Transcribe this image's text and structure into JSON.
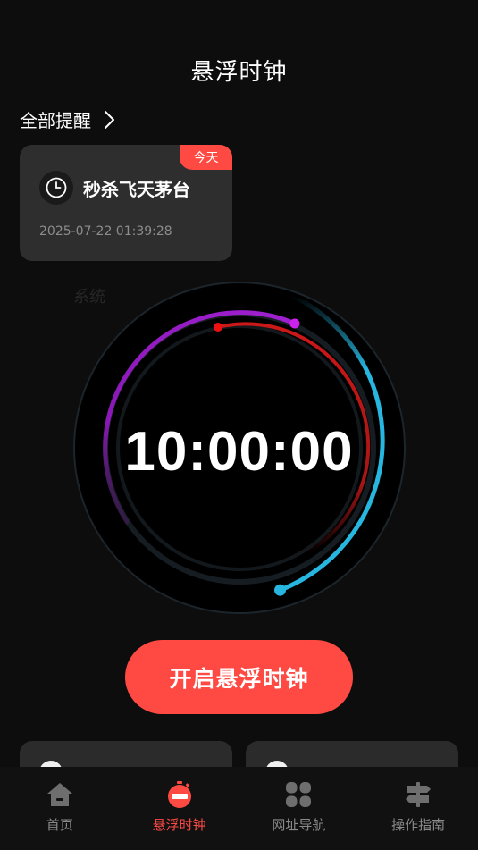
{
  "header": {
    "title": "悬浮时钟"
  },
  "reminders": {
    "all_label": "全部提醒",
    "card": {
      "badge": "今天",
      "title": "秒杀飞天茅台",
      "time": "2025-07-22 01:39:28"
    }
  },
  "ghost_label": "系统",
  "clock": {
    "time": "10:00:00"
  },
  "start_button": {
    "label": "开启悬浮时钟"
  },
  "tabs": [
    {
      "label": "首页",
      "icon": "home-icon",
      "active": false
    },
    {
      "label": "悬浮时钟",
      "icon": "stopwatch-icon",
      "active": true
    },
    {
      "label": "网址导航",
      "icon": "grid-icon",
      "active": false
    },
    {
      "label": "操作指南",
      "icon": "signpost-icon",
      "active": false
    }
  ],
  "colors": {
    "accent": "#ff4a44",
    "background": "#0d0d0d",
    "card": "#2e2e2e",
    "ring_blue": "#27b6e0",
    "ring_purple": "#9a1ec4",
    "ring_red": "#c01818",
    "tab_inactive": "#8a8a8a"
  }
}
